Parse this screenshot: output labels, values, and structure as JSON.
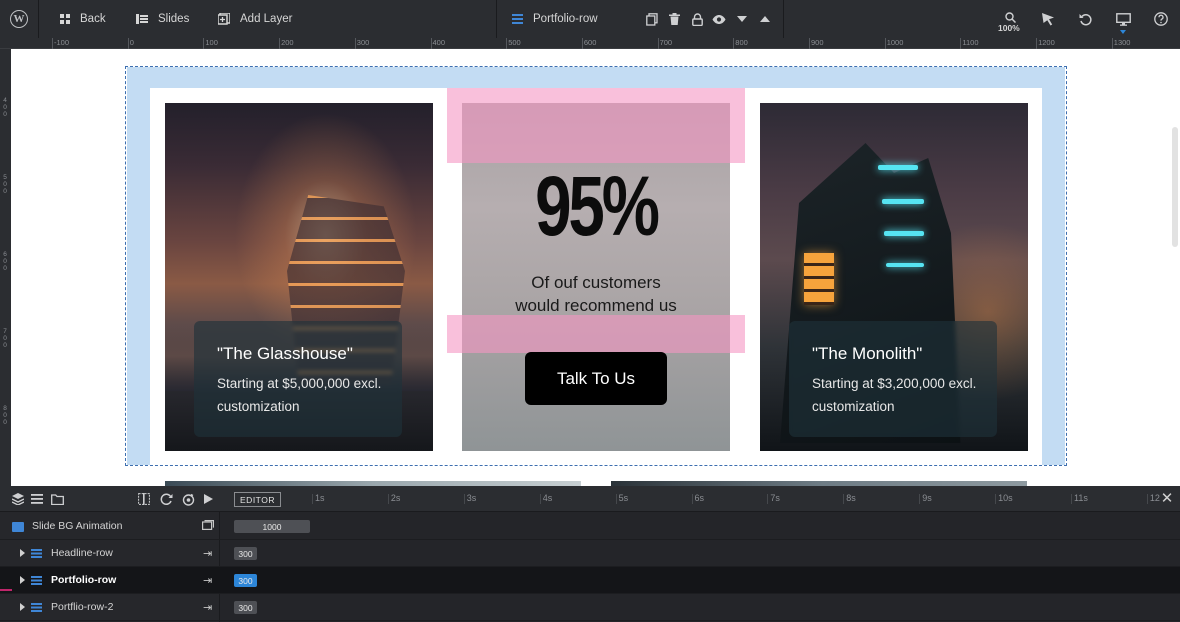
{
  "toolbar": {
    "back_label": "Back",
    "slides_label": "Slides",
    "add_layer_label": "Add Layer",
    "layer_name": "Portfolio-row",
    "zoom": "100%"
  },
  "ruler": {
    "labels": [
      "-100",
      "0",
      "100",
      "200",
      "300",
      "400",
      "500",
      "600",
      "700",
      "800",
      "900",
      "1000",
      "1100",
      "1200",
      "1300"
    ],
    "vertical_labels": [
      "4\n0\n0",
      "5\n0\n0",
      "6\n0\n0",
      "7\n0\n0",
      "8\n0\n0"
    ]
  },
  "slide": {
    "stat_value": "95%",
    "stat_text_line1": "Of ouf customers",
    "stat_text_line2": "would recommend us",
    "cta_label": "Talk To Us",
    "card_left": {
      "title": "\"The Glasshouse\"",
      "description": "Starting at $5,000,000 excl. customization"
    },
    "card_right": {
      "title": "\"The Monolith\"",
      "description": "Starting at $3,200,000 excl. customization"
    }
  },
  "timeline": {
    "editor_label": "EDITOR",
    "scale": [
      "1s",
      "2s",
      "3s",
      "4s",
      "5s",
      "6s",
      "7s",
      "8s",
      "9s",
      "10s",
      "11s",
      "12"
    ],
    "rows": [
      {
        "label": "Slide BG Animation",
        "value": "1000",
        "active": false,
        "expandable": false
      },
      {
        "label": "Headline-row",
        "value": "300",
        "active": false,
        "expandable": true
      },
      {
        "label": "Portfolio-row",
        "value": "300",
        "active": true,
        "expandable": true
      },
      {
        "label": "Portflio-row-2",
        "value": "300",
        "active": false,
        "expandable": true
      }
    ]
  },
  "colors": {
    "accent": "#2d86d8",
    "selection_pink": "#f596c3",
    "row_bg": "#c3dcf3"
  }
}
